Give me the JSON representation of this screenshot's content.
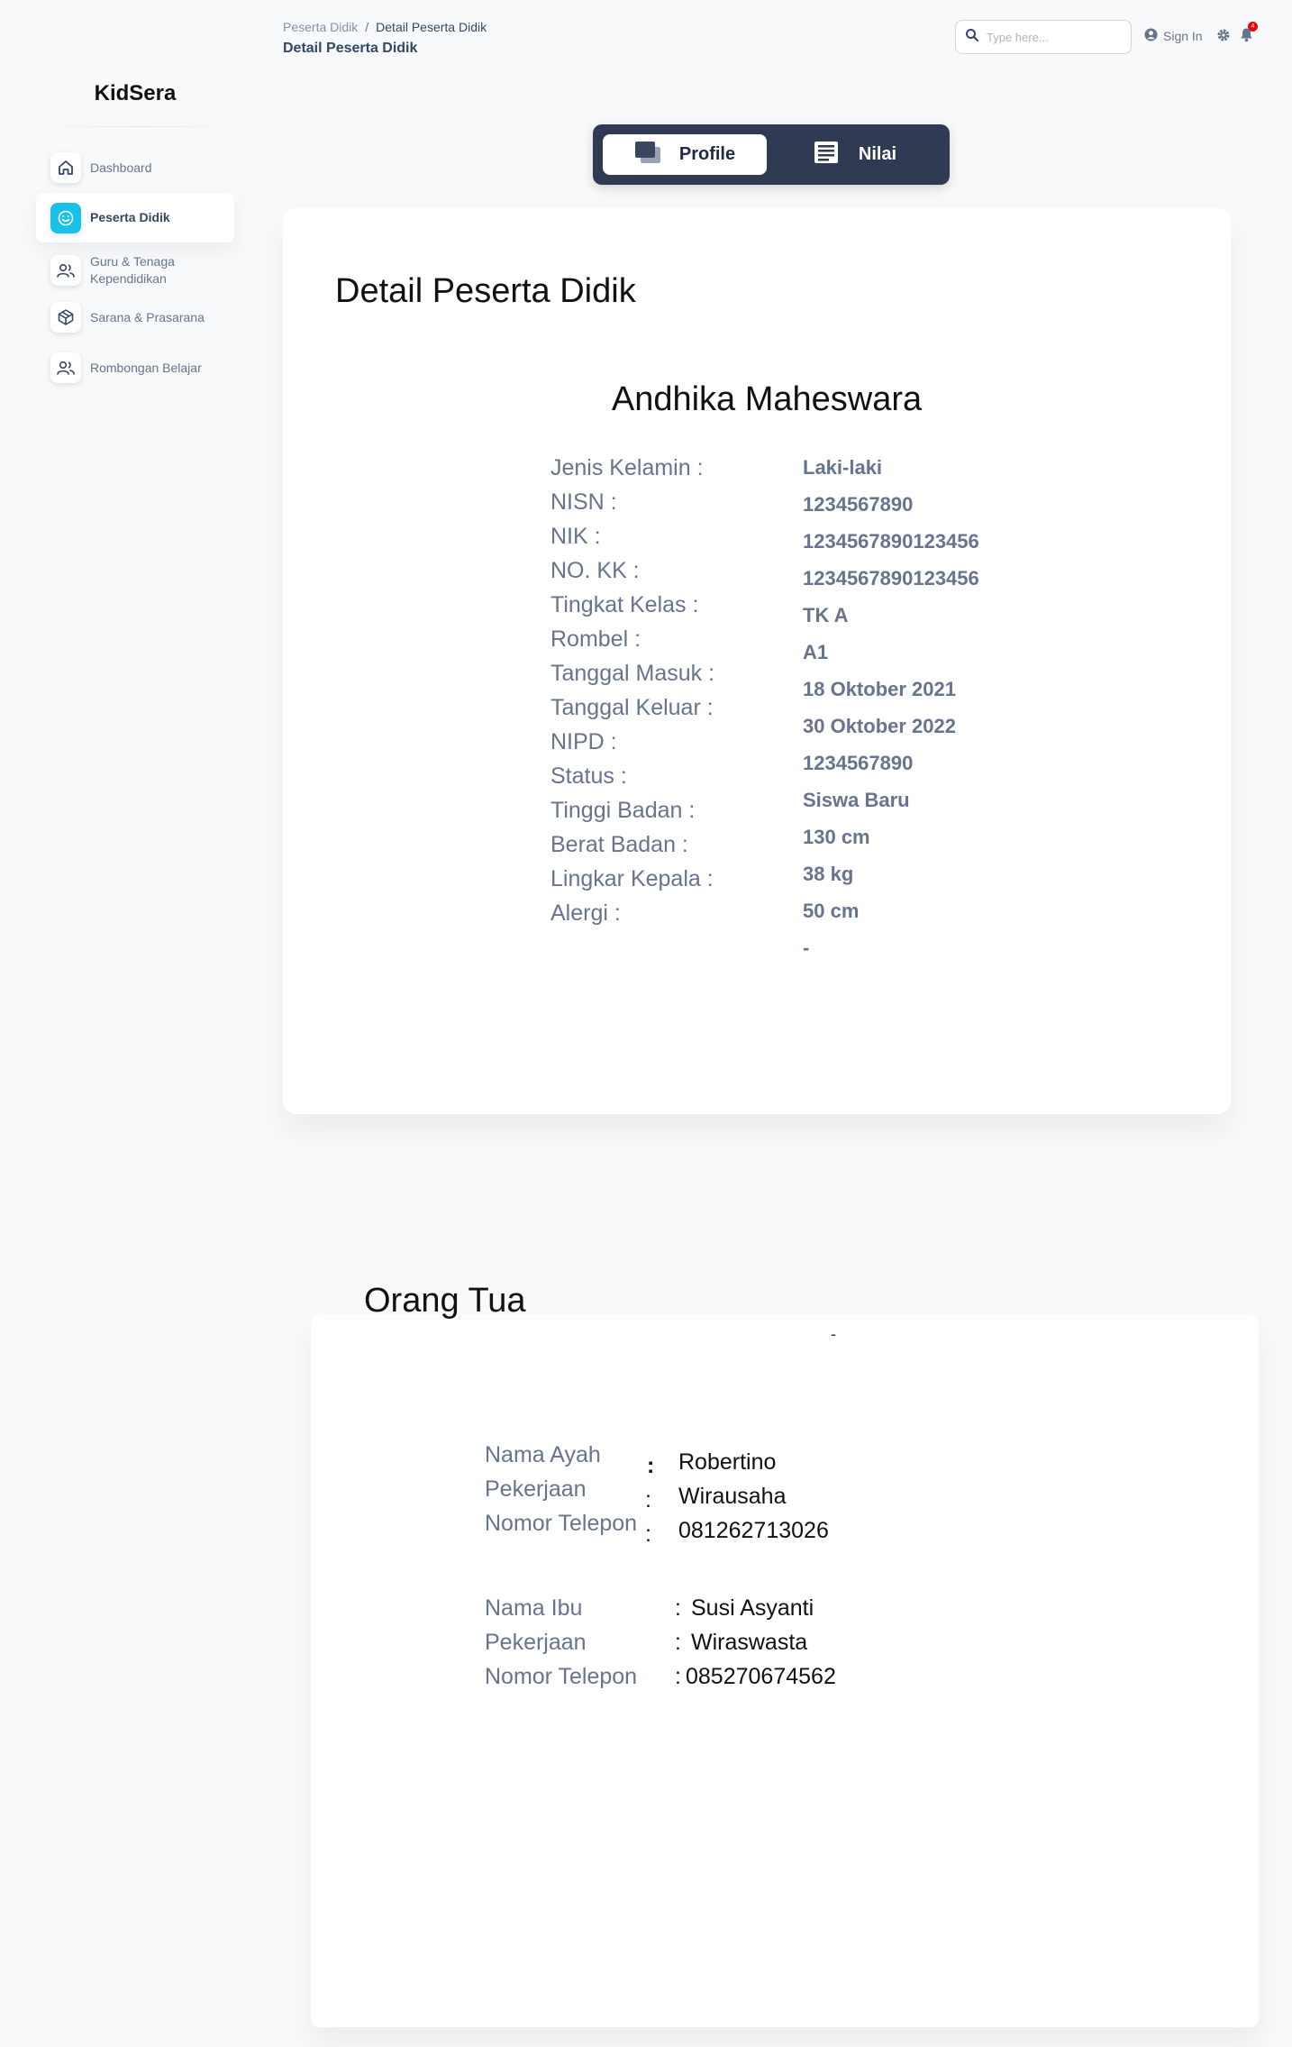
{
  "header": {
    "breadcrumb": {
      "parent": "Peserta Didik",
      "separator": "/",
      "current": "Detail Peserta Didik"
    },
    "title": "Detail Peserta Didik",
    "search_placeholder": "Type here...",
    "sign_in": "Sign In",
    "notification_count": "4"
  },
  "sidebar": {
    "brand": "KidSera",
    "items": [
      {
        "label": "Dashboard",
        "icon": "home-icon",
        "active": false
      },
      {
        "label": "Peserta Didik",
        "icon": "smile-icon",
        "active": true
      },
      {
        "label": "Guru & Tenaga Kependidikan",
        "icon": "users-icon",
        "active": false
      },
      {
        "label": "Sarana & Prasarana",
        "icon": "box-icon",
        "active": false
      },
      {
        "label": "Rombongan Belajar",
        "icon": "users-icon",
        "active": false
      }
    ]
  },
  "tabs": {
    "profile": "Profile",
    "nilai": "Nilai"
  },
  "detail": {
    "title": "Detail Peserta Didik",
    "name": "Andhika Maheswara",
    "labels": [
      "Jenis Kelamin :",
      "NISN :",
      "NIK :",
      "NO. KK :",
      "Tingkat Kelas :",
      "Rombel :",
      "Tanggal Masuk :",
      "Tanggal Keluar :",
      "NIPD :",
      "Status :",
      "Tinggi Badan :",
      "Berat Badan :",
      "Lingkar Kepala :",
      "Alergi :"
    ],
    "values": [
      "Laki-laki",
      "1234567890",
      "1234567890123456",
      "1234567890123456",
      "TK A",
      "A1",
      "18 Oktober 2021",
      "30 Oktober 2022",
      "1234567890",
      "Siswa Baru",
      "130 cm",
      "38 kg",
      "50 cm",
      "-"
    ]
  },
  "orang_tua": {
    "title": "Orang Tua",
    "dash": "-",
    "ayah": {
      "nama_label": "Nama Ayah",
      "nama": "Robertino",
      "pekerjaan_label": "Pekerjaan",
      "pekerjaan": "Wirausaha",
      "telepon_label": "Nomor Telepon",
      "telepon": "081262713026"
    },
    "ibu": {
      "nama_label": "Nama Ibu",
      "nama": "Susi Asyanti",
      "pekerjaan_label": "Pekerjaan",
      "pekerjaan": "Wiraswasta",
      "telepon_label": "Nomor Telepon",
      "telepon": "085270674562"
    },
    "colon": ":"
  },
  "colors": {
    "accent": "#17c1e8",
    "tab_bar": "#303a52",
    "text_muted": "#67748e",
    "badge": "#ea0606"
  }
}
